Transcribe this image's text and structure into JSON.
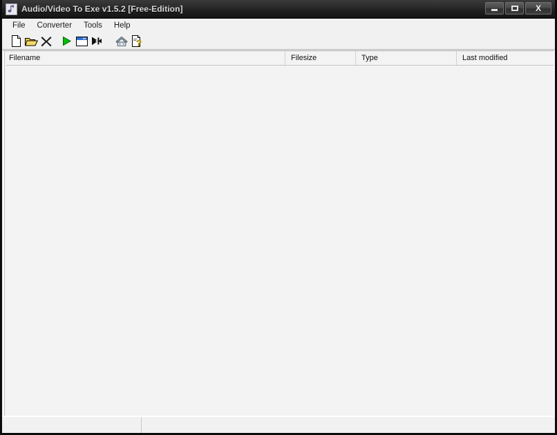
{
  "window": {
    "title": "Audio/Video To Exe v1.5.2 [Free-Edition]",
    "icon": "music-note-icon",
    "controls": {
      "minimize_label": "",
      "maximize_label": "",
      "close_label": "X"
    }
  },
  "menubar": {
    "items": [
      {
        "label": "File"
      },
      {
        "label": "Converter"
      },
      {
        "label": "Tools"
      },
      {
        "label": "Help"
      }
    ]
  },
  "toolbar": {
    "buttons": [
      {
        "name": "new-file-icon",
        "tooltip": "New"
      },
      {
        "name": "open-folder-icon",
        "tooltip": "Open"
      },
      {
        "name": "remove-x-icon",
        "tooltip": "Remove"
      },
      {
        "name": "play-icon",
        "tooltip": "Start"
      },
      {
        "name": "window-icon",
        "tooltip": "Window"
      },
      {
        "name": "merge-arrows-icon",
        "tooltip": "Join"
      },
      {
        "name": "home-icon",
        "tooltip": "Homepage"
      },
      {
        "name": "help-document-icon",
        "tooltip": "Help"
      }
    ]
  },
  "filelist": {
    "columns": [
      {
        "label": "Filename"
      },
      {
        "label": "Filesize"
      },
      {
        "label": "Type"
      },
      {
        "label": "Last modified"
      }
    ],
    "rows": []
  },
  "statusbar": {
    "panels": [
      {
        "text": ""
      },
      {
        "text": ""
      }
    ]
  },
  "colors": {
    "titlebar_dark": "#2c2c2c",
    "title_text": "#d8d8d8",
    "chrome": "#f1f1f1",
    "list_bg": "#f3f3f3",
    "play_green": "#00c000",
    "folder_yellow": "#e8a811",
    "help_yellow": "#f5d800"
  }
}
